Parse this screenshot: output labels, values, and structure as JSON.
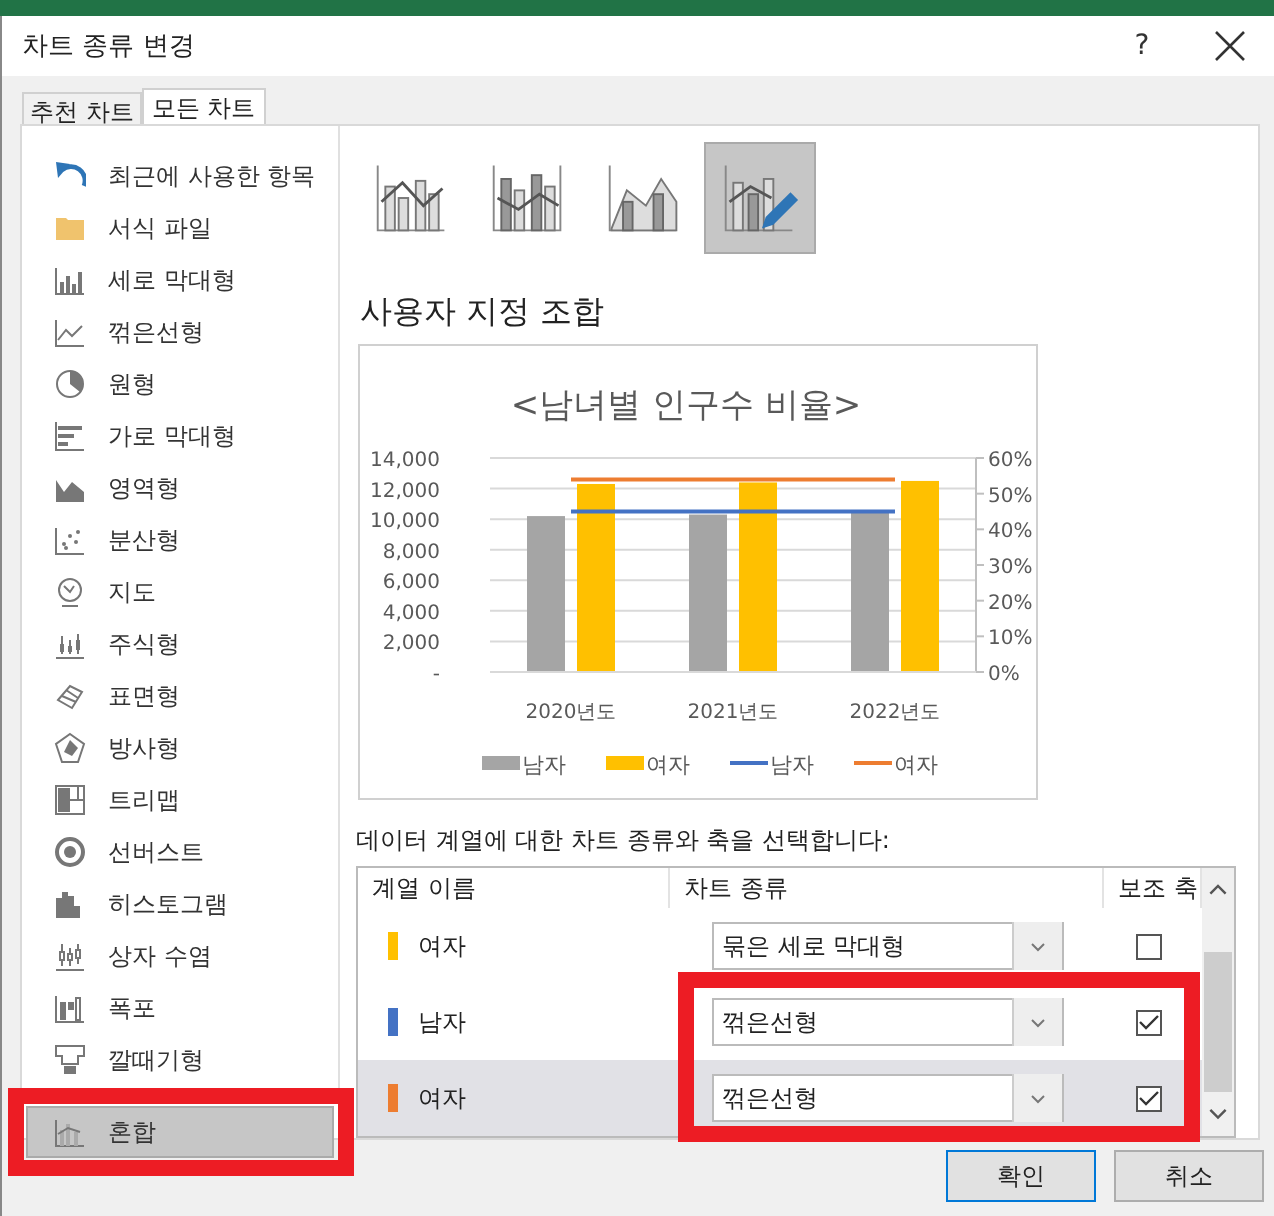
{
  "window": {
    "title": "차트 종류 변경",
    "help": "?"
  },
  "tabs": [
    {
      "label": "추천 차트",
      "selected": false
    },
    {
      "label": "모든 차트",
      "selected": true
    }
  ],
  "sidebar": {
    "items": [
      {
        "label": "최근에 사용한 항목",
        "selected": false,
        "highlighted": false
      },
      {
        "label": "서식 파일",
        "selected": false,
        "highlighted": false
      },
      {
        "label": "세로 막대형",
        "selected": false,
        "highlighted": false
      },
      {
        "label": "꺾은선형",
        "selected": false,
        "highlighted": false
      },
      {
        "label": "원형",
        "selected": false,
        "highlighted": false
      },
      {
        "label": "가로 막대형",
        "selected": false,
        "highlighted": false
      },
      {
        "label": "영역형",
        "selected": false,
        "highlighted": false
      },
      {
        "label": "분산형",
        "selected": false,
        "highlighted": false
      },
      {
        "label": "지도",
        "selected": false,
        "highlighted": false
      },
      {
        "label": "주식형",
        "selected": false,
        "highlighted": false
      },
      {
        "label": "표면형",
        "selected": false,
        "highlighted": false
      },
      {
        "label": "방사형",
        "selected": false,
        "highlighted": false
      },
      {
        "label": "트리맵",
        "selected": false,
        "highlighted": false
      },
      {
        "label": "선버스트",
        "selected": false,
        "highlighted": false
      },
      {
        "label": "히스토그램",
        "selected": false,
        "highlighted": false
      },
      {
        "label": "상자 수염",
        "selected": false,
        "highlighted": false
      },
      {
        "label": "폭포",
        "selected": false,
        "highlighted": false
      },
      {
        "label": "깔때기형",
        "selected": false,
        "highlighted": false
      },
      {
        "label": "혼합",
        "selected": true,
        "highlighted": true
      }
    ]
  },
  "subtypes": [
    {
      "selected": false
    },
    {
      "selected": false
    },
    {
      "selected": false
    },
    {
      "selected": true
    }
  ],
  "heading": "사용자 지정 조합",
  "chart": {
    "chart_data": {
      "type": "bar",
      "title": "<남녀별 인구수 비율>",
      "categories": [
        "2020년도",
        "2021년도",
        "2022년도"
      ],
      "series": [
        {
          "name": "남자",
          "color": "#a5a5a5",
          "type": "bar",
          "values": [
            10200,
            10300,
            10600
          ]
        },
        {
          "name": "여자",
          "color": "#ffc000",
          "type": "bar",
          "values": [
            12300,
            12400,
            12500
          ]
        },
        {
          "name": "남자",
          "color": "#4472c4",
          "type": "line",
          "axis": "y2",
          "values": [
            45,
            45,
            45
          ]
        },
        {
          "name": "여자",
          "color": "#ed7d31",
          "type": "line",
          "axis": "y2",
          "values": [
            54,
            54,
            54
          ]
        }
      ],
      "grid": true,
      "legend": true,
      "ylim": [
        0,
        14000
      ],
      "yticks": [
        {
          "value": 0,
          "label": "-"
        },
        {
          "value": 2000,
          "label": "2,000"
        },
        {
          "value": 4000,
          "label": "4,000"
        },
        {
          "value": 6000,
          "label": "6,000"
        },
        {
          "value": 8000,
          "label": "8,000"
        },
        {
          "value": 10000,
          "label": "10,000"
        },
        {
          "value": 12000,
          "label": "12,000"
        },
        {
          "value": 14000,
          "label": "14,000"
        }
      ],
      "y2lim": [
        0,
        60
      ],
      "y2ticks": [
        {
          "value": 0,
          "label": "0%"
        },
        {
          "value": 10,
          "label": "10%"
        },
        {
          "value": 20,
          "label": "20%"
        },
        {
          "value": 30,
          "label": "30%"
        },
        {
          "value": 40,
          "label": "40%"
        },
        {
          "value": 50,
          "label": "50%"
        },
        {
          "value": 60,
          "label": "60%"
        }
      ]
    }
  },
  "series_prompt": "데이터 계열에 대한 차트 종류와 축을 선택합니다:",
  "series_table": {
    "columns": [
      "계열 이름",
      "차트 종류",
      "보조 축"
    ],
    "rows": [
      {
        "name": "여자",
        "color": "#ffc000",
        "chart_type": "묶은 세로 막대형",
        "secondary_axis": false,
        "selected": false,
        "highlighted": false
      },
      {
        "name": "남자",
        "color": "#4472c4",
        "chart_type": "꺾은선형",
        "secondary_axis": true,
        "selected": false,
        "highlighted": true
      },
      {
        "name": "여자",
        "color": "#ed7d31",
        "chart_type": "꺾은선형",
        "secondary_axis": true,
        "selected": true,
        "highlighted": true
      }
    ]
  },
  "buttons": [
    {
      "label": "확인",
      "kind": "default"
    },
    {
      "label": "취소",
      "kind": "normal"
    }
  ]
}
